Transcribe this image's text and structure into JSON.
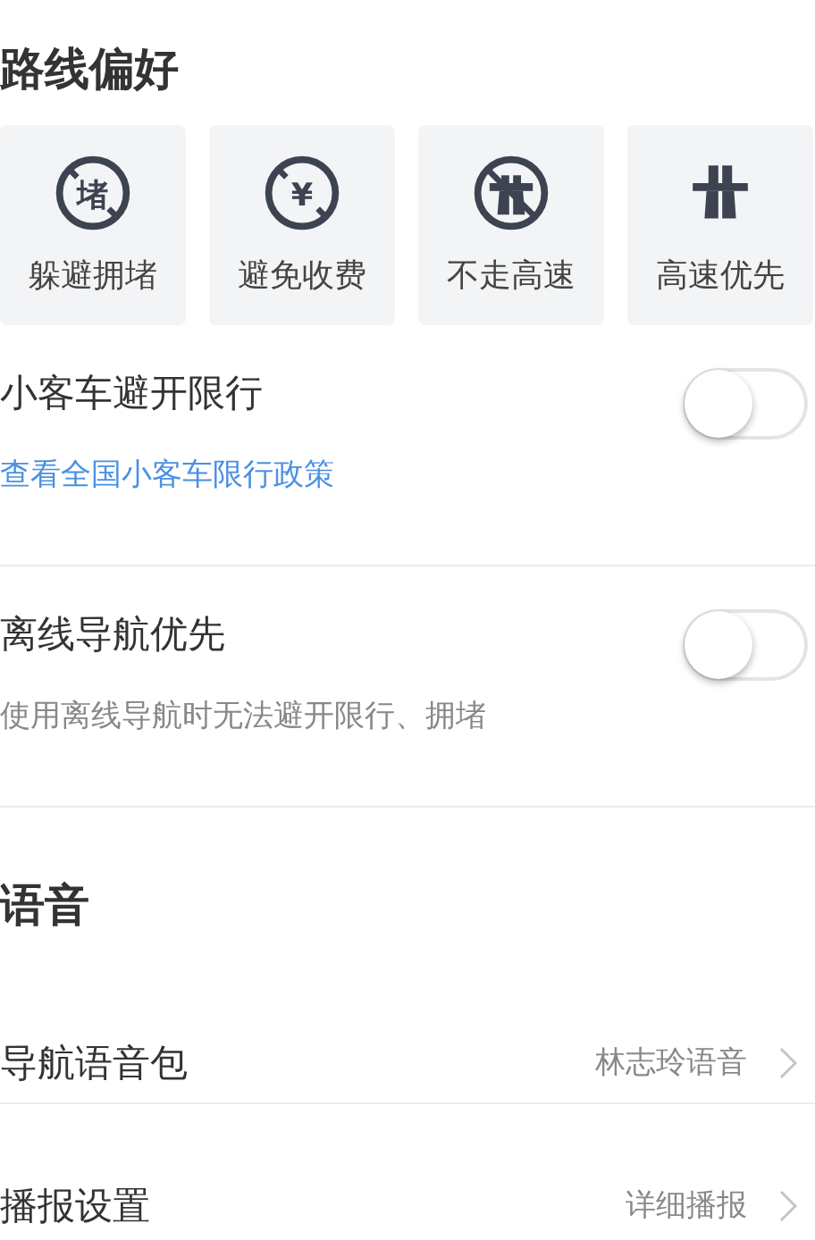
{
  "route_preferences": {
    "title": "路线偏好",
    "options": [
      {
        "kind": "no-jam",
        "glyph": "堵",
        "label": "躲避拥堵"
      },
      {
        "kind": "no-toll",
        "glyph": "¥",
        "label": "避免收费"
      },
      {
        "kind": "no-highway",
        "label": "不走高速"
      },
      {
        "kind": "highway",
        "label": "高速优先"
      }
    ]
  },
  "toggles": [
    {
      "title": "小客车避开限行",
      "subtitle": "查看全国小客车限行政策",
      "subtitle_link": true,
      "on": false
    },
    {
      "title": "离线导航优先",
      "subtitle": "使用离线导航时无法避开限行、拥堵",
      "subtitle_link": false,
      "on": false
    }
  ],
  "voice": {
    "title": "语音",
    "rows": [
      {
        "label": "导航语音包",
        "value": "林志玲语音"
      },
      {
        "label": "播报设置",
        "value": "详细播报"
      }
    ]
  }
}
